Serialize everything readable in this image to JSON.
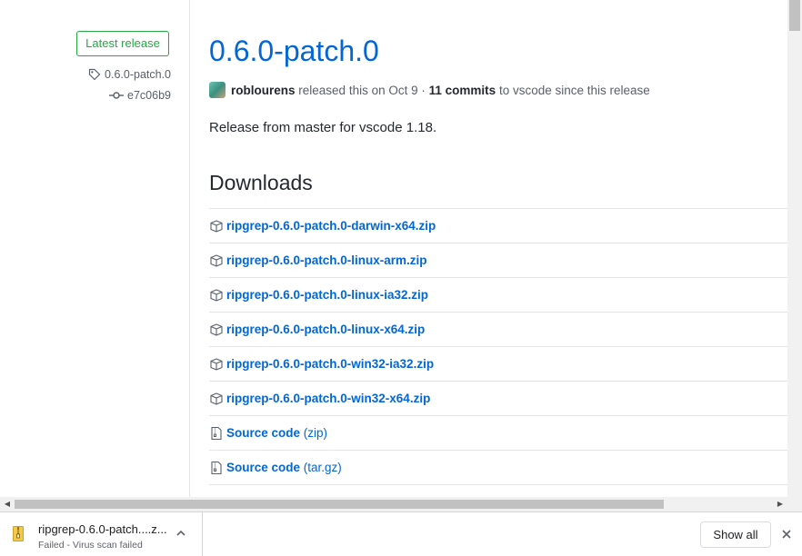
{
  "sidebar": {
    "badge": "Latest release",
    "tag": "0.6.0-patch.0",
    "commit": "e7c06b9"
  },
  "release": {
    "title": "0.6.0-patch.0",
    "author": "roblourens",
    "released_text": "released this on Oct 9 ·",
    "commits": "11 commits",
    "commits_tail": "to vscode since this release",
    "body": "Release from master for vscode 1.18.",
    "downloads_heading": "Downloads"
  },
  "assets": [
    {
      "name": "ripgrep-0.6.0-patch.0-darwin-x64.zip",
      "icon": "package-icon"
    },
    {
      "name": "ripgrep-0.6.0-patch.0-linux-arm.zip",
      "icon": "package-icon"
    },
    {
      "name": "ripgrep-0.6.0-patch.0-linux-ia32.zip",
      "icon": "package-icon"
    },
    {
      "name": "ripgrep-0.6.0-patch.0-linux-x64.zip",
      "icon": "package-icon"
    },
    {
      "name": "ripgrep-0.6.0-patch.0-win32-ia32.zip",
      "icon": "package-icon"
    },
    {
      "name": "ripgrep-0.6.0-patch.0-win32-x64.zip",
      "icon": "package-icon"
    }
  ],
  "sources": [
    {
      "label": "Source code",
      "format": "(zip)",
      "icon": "file-zip-icon"
    },
    {
      "label": "Source code",
      "format": "(tar.gz)",
      "icon": "file-zip-icon"
    }
  ],
  "download_shelf": {
    "filename": "ripgrep-0.6.0-patch....z...",
    "status": "Failed - Virus scan failed",
    "show_all": "Show all"
  },
  "colors": {
    "link": "#0366d6",
    "badge_green": "#28a745",
    "muted": "#586069"
  }
}
